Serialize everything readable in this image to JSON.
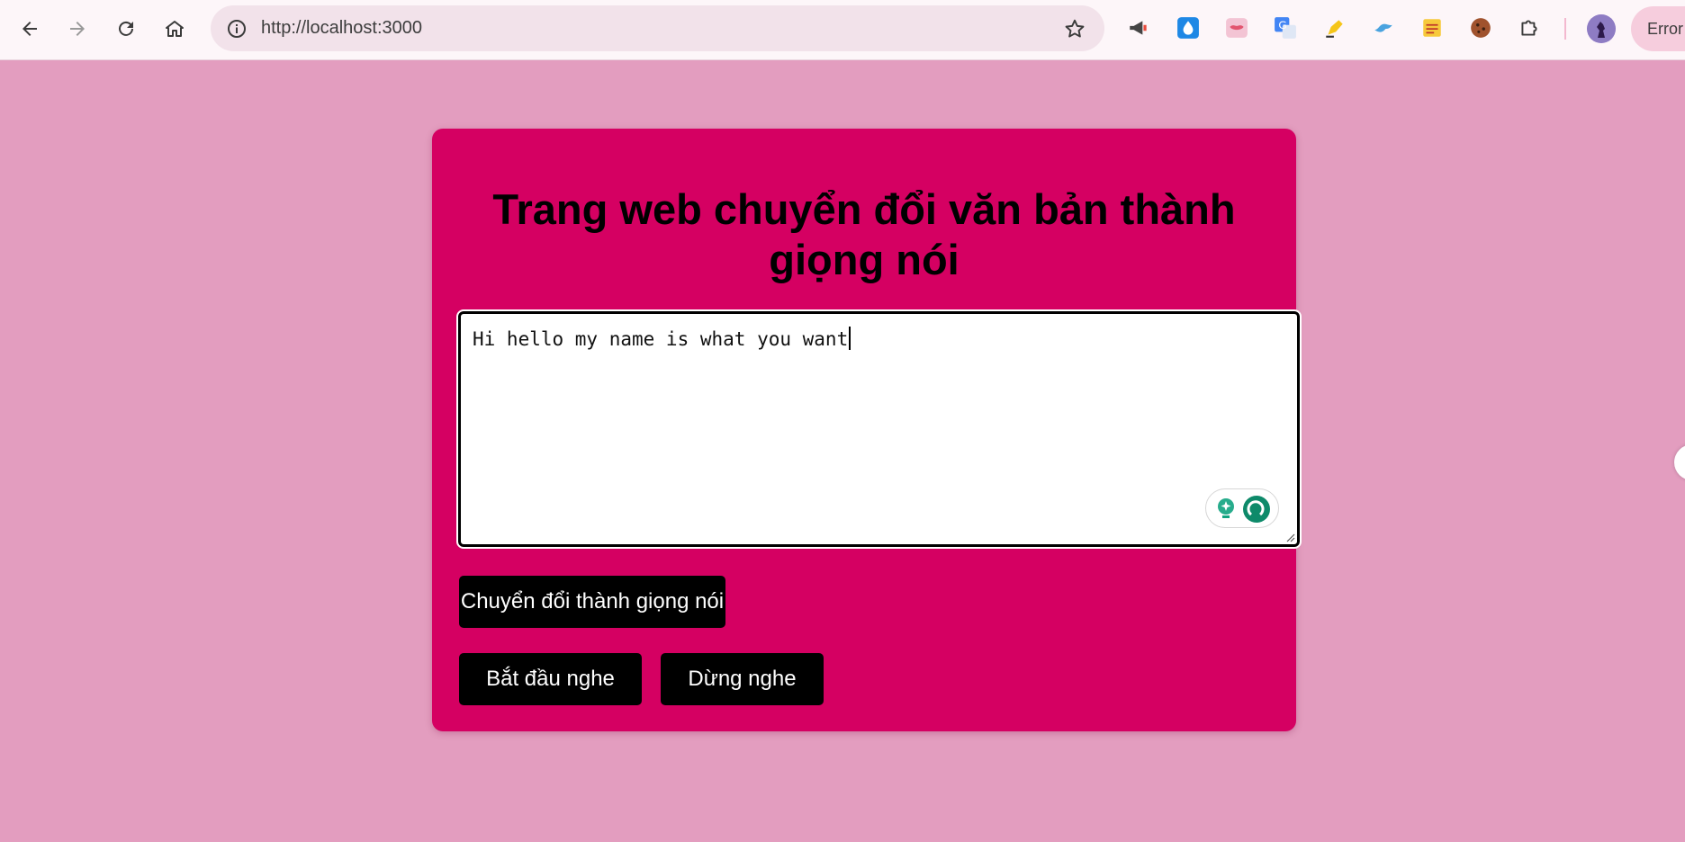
{
  "browser": {
    "url": "http://localhost:3000",
    "error_chip": "Error"
  },
  "page": {
    "title": "Trang web chuyển đổi văn bản thành giọng nói",
    "textarea_value": "Hi hello my name is what you want",
    "convert_button": "Chuyển đổi thành giọng nói",
    "start_button": "Bắt đầu nghe",
    "stop_button": "Dừng nghe"
  },
  "colors": {
    "page_background": "#e39dbf",
    "card_background": "#d50062",
    "button_background": "#000000",
    "button_text": "#ffffff"
  },
  "extensions": [
    "megaphone-icon",
    "water-drop-icon",
    "lips-icon",
    "translate-icon",
    "highlighter-icon",
    "bird-icon",
    "notes-icon",
    "cookie-icon",
    "puzzle-icon"
  ]
}
